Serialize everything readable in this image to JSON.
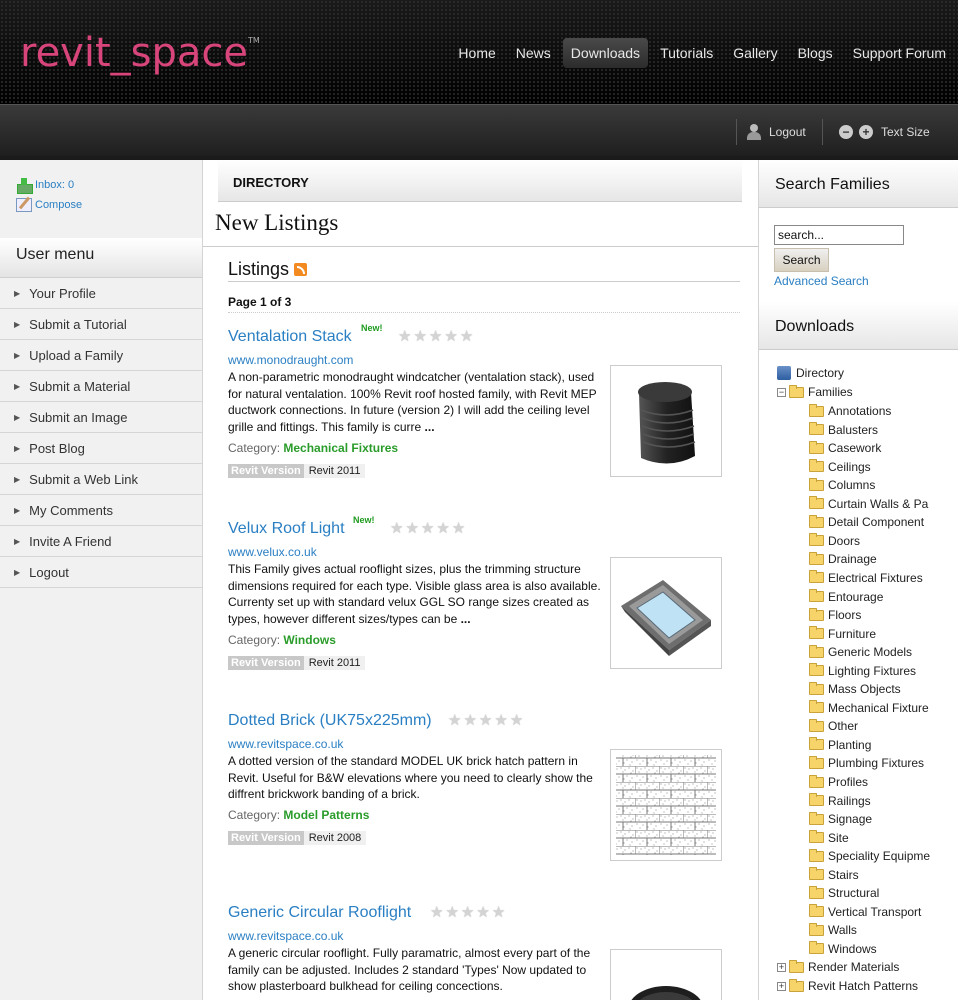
{
  "header": {
    "logo": "revit_space",
    "logo_tm": "TM",
    "nav": [
      "Home",
      "News",
      "Downloads",
      "Tutorials",
      "Gallery",
      "Blogs",
      "Support Forum"
    ],
    "active_nav": "Downloads"
  },
  "subbar": {
    "logout": "Logout",
    "text_size": "Text Size"
  },
  "left": {
    "inbox": "Inbox: 0",
    "compose": "Compose",
    "user_menu_title": "User menu",
    "user_menu": [
      "Your Profile",
      "Submit a Tutorial",
      "Upload a Family",
      "Submit a Material",
      "Submit an Image",
      "Post Blog",
      "Submit a Web Link",
      "My Comments",
      "Invite A Friend",
      "Logout"
    ]
  },
  "center": {
    "directory": "DIRECTORY",
    "new_listings": "New Listings",
    "listings": "Listings",
    "page_count": "Page 1 of 3",
    "items": [
      {
        "title": "Ventalation Stack",
        "badge": "New!",
        "url": "www.monodraught.com",
        "desc": "A non-parametric monodraught windcatcher (ventalation stack), used for natural ventalation. 100% Revit roof hosted family, with Revit MEP ductwork connections. In future (version 2) I will add the ceiling level grille and fittings. This family is curre",
        "more": "...",
        "category_label": "Category:",
        "category": "Mechanical Fixtures",
        "version_label": "Revit Version",
        "version": "Revit 2011",
        "rating": 0
      },
      {
        "title": "Velux Roof Light",
        "badge": "New!",
        "url": "www.velux.co.uk",
        "desc": "This Family gives actual rooflight sizes, plus the trimming structure dimensions required for each type. Visible glass area is also available. Currenty set up with standard velux GGL SO range sizes created as types, however different sizes/types can be",
        "more": "...",
        "category_label": "Category:",
        "category": "Windows",
        "version_label": "Revit Version",
        "version": "Revit 2011",
        "rating": 0
      },
      {
        "title": "Dotted Brick (UK75x225mm)",
        "badge": "",
        "url": "www.revitspace.co.uk",
        "desc": "A dotted version of the standard MODEL UK brick hatch pattern in Revit. Useful for B&W elevations where you need to clearly show the diffrent brickwork banding of a brick.",
        "more": "",
        "category_label": "Category:",
        "category": "Model Patterns",
        "version_label": "Revit Version",
        "version": "Revit 2008",
        "rating": 0
      },
      {
        "title": "Generic Circular Rooflight",
        "badge": "",
        "url": "www.revitspace.co.uk",
        "desc": "A generic circular rooflight. Fully paramatric, almost every part of the family can be adjusted. Includes 2 standard 'Types' Now updated to show plasterboard bulkhead for ceiling concections.",
        "more": "",
        "rating": 0
      }
    ]
  },
  "right": {
    "search_title": "Search Families",
    "search_value": "search...",
    "search_button": "Search",
    "advanced_search": "Advanced Search",
    "downloads_title": "Downloads",
    "tree_root": "Directory",
    "tree_families": "Families",
    "tree_children": [
      "Annotations",
      "Balusters",
      "Casework",
      "Ceilings",
      "Columns",
      "Curtain Walls & Pa",
      "Detail Component",
      "Doors",
      "Drainage",
      "Electrical Fixtures",
      "Entourage",
      "Floors",
      "Furniture",
      "Generic Models",
      "Lighting Fixtures",
      "Mass Objects",
      "Mechanical Fixture",
      "Other",
      "Planting",
      "Plumbing Fixtures",
      "Profiles",
      "Railings",
      "Signage",
      "Site",
      "Speciality Equipme",
      "Stairs",
      "Structural",
      "Vertical Transport",
      "Walls",
      "Windows"
    ],
    "tree_more": [
      "Render Materials",
      "Revit Hatch Patterns"
    ],
    "expander_minus": "−",
    "expander_plus": "+"
  }
}
